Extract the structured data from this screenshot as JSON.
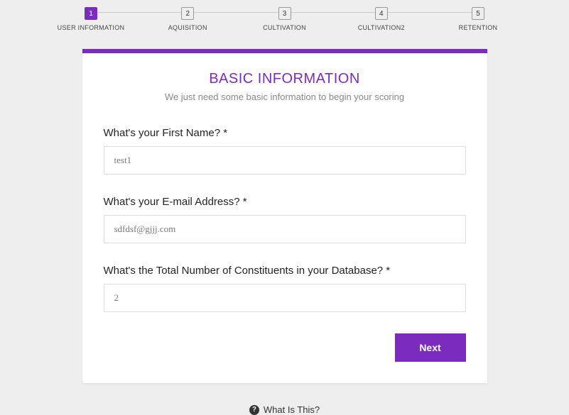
{
  "stepper": {
    "steps": [
      {
        "num": "1",
        "label": "USER INFORMATION",
        "active": true
      },
      {
        "num": "2",
        "label": "AQUISITION",
        "active": false
      },
      {
        "num": "3",
        "label": "CULTIVATION",
        "active": false
      },
      {
        "num": "4",
        "label": "CULTIVATION2",
        "active": false
      },
      {
        "num": "5",
        "label": "RETENTION",
        "active": false
      }
    ]
  },
  "card": {
    "title": "BASIC INFORMATION",
    "subtitle": "We just need some basic information to begin your scoring"
  },
  "form": {
    "first_name": {
      "label": "What's your First Name? *",
      "value": "test1"
    },
    "email": {
      "label": "What's your E-mail Address? *",
      "value": "sdfdsf@gjjj.com"
    },
    "constituents": {
      "label": "What's the Total Number of Constituents in your Database? *",
      "value": "2"
    },
    "next_label": "Next"
  },
  "footer": {
    "help_label": "What Is This?"
  }
}
